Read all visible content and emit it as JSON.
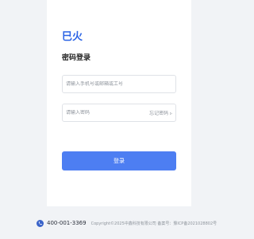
{
  "brand": {
    "logo_text": "巳火",
    "color": "#2c64e5"
  },
  "login": {
    "heading": "密码登录",
    "username_placeholder": "请输入手机号或邮箱或工号",
    "password_placeholder": "请输入密码",
    "forgot_label": "忘记密码 ▹",
    "submit_label": "登录",
    "button_color": "#4d7ef2"
  },
  "footer": {
    "phone_icon": "phone-icon",
    "phone": "400-001-3369",
    "copyright": "Copyright©2025中鑫科技有限公司 备案号：豫ICP备2021028802号"
  }
}
